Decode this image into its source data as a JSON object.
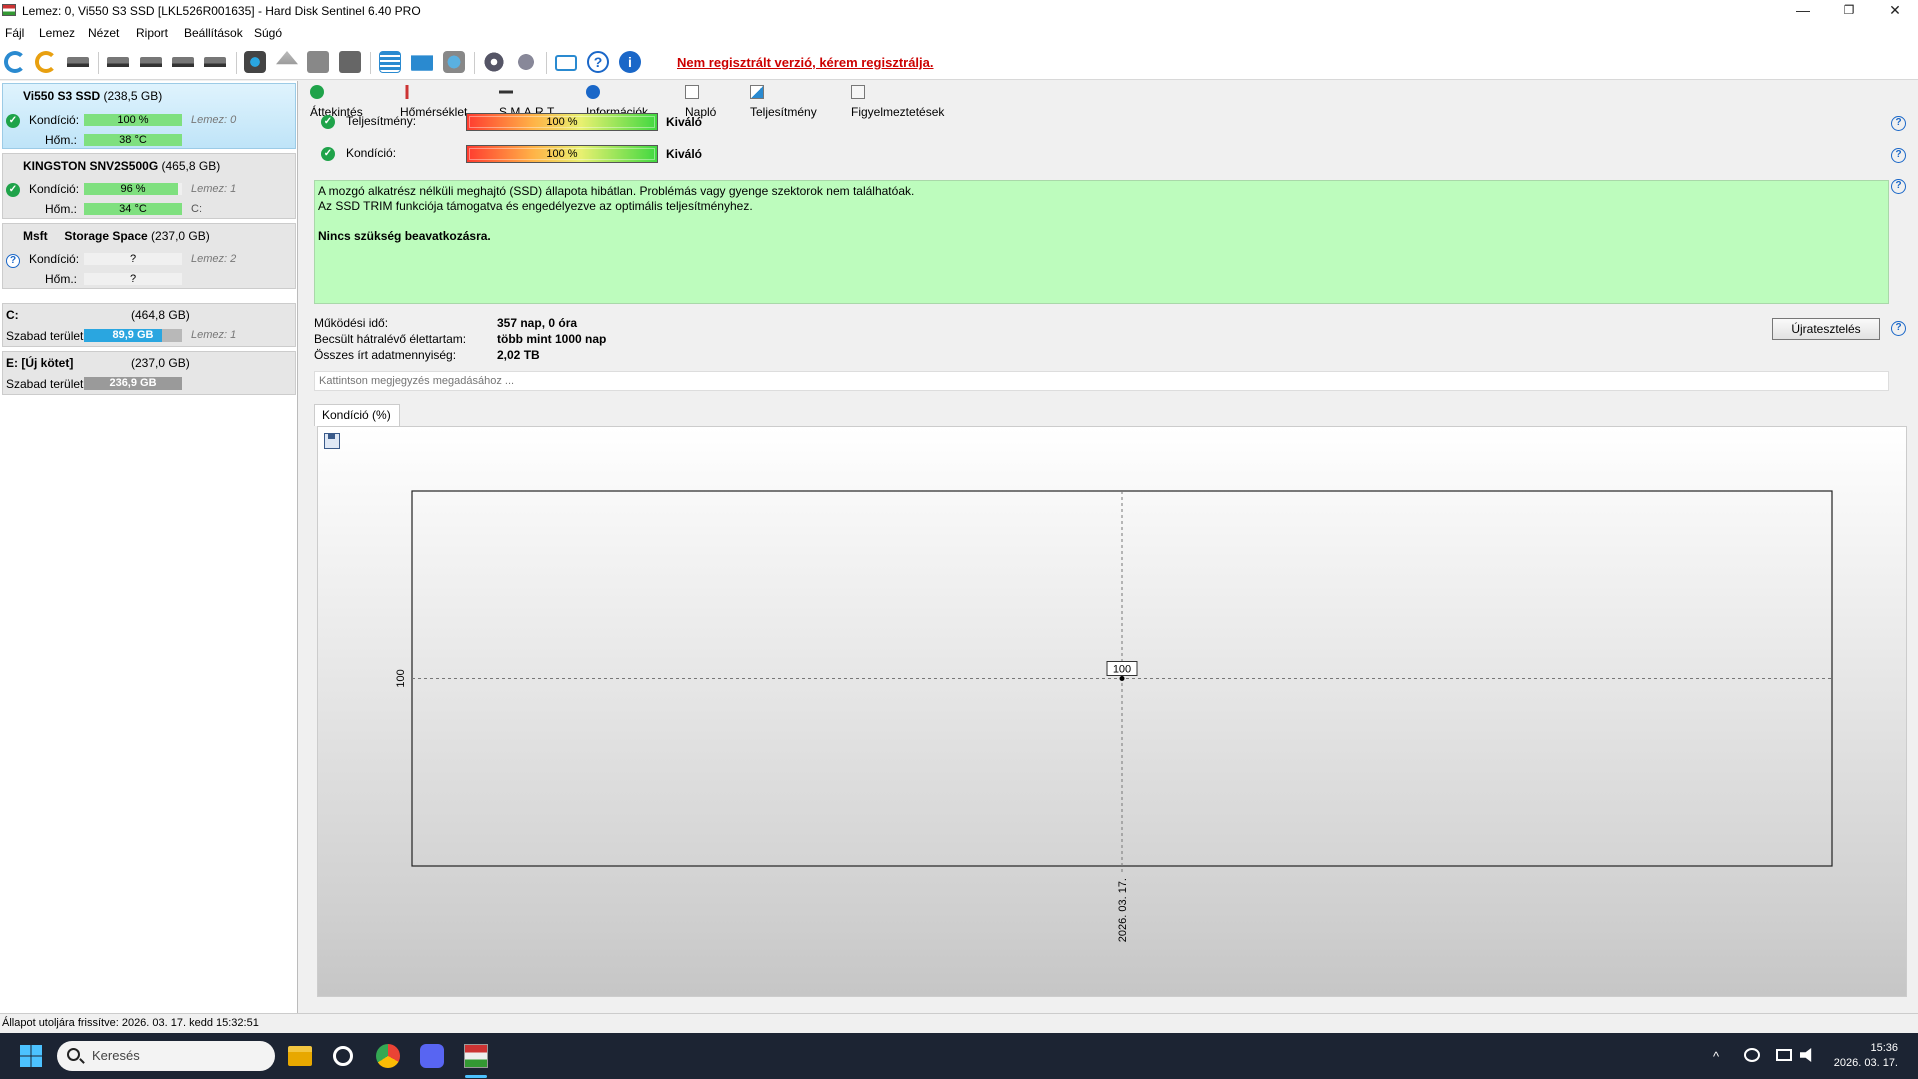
{
  "window": {
    "title": "Lemez: 0, Vi550 S3 SSD [LKL526R001635]  -  Hard Disk Sentinel 6.40 PRO",
    "minimize": "—",
    "maximize": "❐",
    "close": "✕"
  },
  "menu": [
    "Fájl",
    "Lemez",
    "Nézet",
    "Riport",
    "Beállítások",
    "Súgó"
  ],
  "toolbar": {
    "register_link": "Nem regisztrált verzió, kérem regisztrálja."
  },
  "disks": [
    {
      "name": "Vi550 S3 SSD",
      "size": "(238,5 GB)",
      "condition_label": "Kondíció:",
      "condition": "100 %",
      "condition_pct": 100,
      "temp_label": "Hőm.:",
      "temp": "38 °C",
      "temp_pct": 100,
      "note": "Lemez: 0",
      "note2": "",
      "status": "ok"
    },
    {
      "name": "KINGSTON SNV2S500G",
      "size": "(465,8 GB)",
      "condition_label": "Kondíció:",
      "condition": "96 %",
      "condition_pct": 96,
      "temp_label": "Hőm.:",
      "temp": "34 °C",
      "temp_pct": 100,
      "note": "Lemez: 1",
      "note2": "C:",
      "status": "ok"
    },
    {
      "name": "Msft     Storage Space",
      "size": "(237,0 GB)",
      "condition_label": "Kondíció:",
      "condition": "?",
      "condition_pct": 0,
      "temp_label": "Hőm.:",
      "temp": "?",
      "temp_pct": 0,
      "note": "Lemez: 2",
      "note2": "",
      "status": "unknown"
    }
  ],
  "volumes": [
    {
      "name": "C:",
      "size": "(464,8 GB)",
      "free_label": "Szabad terület",
      "free": "89,9 GB",
      "free_pct": 19,
      "note": "Lemez: 1"
    },
    {
      "name": "E: [Új kötet]",
      "size": "(237,0 GB)",
      "free_label": "Szabad terület",
      "free": "236,9 GB",
      "free_pct": 0,
      "note": ""
    }
  ],
  "tabs": [
    "Áttekintés",
    "Hőmérséklet",
    "S.M.A.R.T.",
    "Információk",
    "Napló",
    "Teljesítmény",
    "Figyelmeztetések"
  ],
  "overview": {
    "performance_label": "Teljesítmény:",
    "performance_value": "100 %",
    "performance_word": "Kiváló",
    "condition_label": "Kondíció:",
    "condition_value": "100 %",
    "condition_word": "Kiváló",
    "message_line1": "A mozgó alkatrész nélküli meghajtó (SSD) állapota hibátlan. Problémás vagy gyenge szektorok nem találhatóak.",
    "message_line2": "Az SSD TRIM funkciója támogatva és engedélyezve az optimális teljesítményhez.",
    "message_bold": "Nincs szükség beavatkozásra.",
    "uptime_label": "Működési idő:",
    "uptime_value": "357 nap, 0 óra",
    "remaining_label": "Becsült hátralévő élettartam:",
    "remaining_value": "több mint 1000 nap",
    "written_label": "Összes írt adatmennyiség:",
    "written_value": "2,02 TB",
    "retest_button": "Újratesztelés",
    "note_placeholder": "Kattintson megjegyzés megadásához ..."
  },
  "chart_tab": "Kondíció  (%)",
  "chart_data": {
    "type": "line",
    "title": "",
    "xlabel": "",
    "ylabel": "",
    "x": [
      "2026. 03. 17."
    ],
    "series": [
      {
        "values": [
          100
        ]
      }
    ],
    "y_tick_labels": [
      "100"
    ],
    "point_labels": [
      "100"
    ]
  },
  "statusbar": "Állapot utoljára frissítve: 2026. 03. 17. kedd 15:32:51",
  "taskbar": {
    "search_placeholder": "Keresés",
    "time": "15:36",
    "date": "2026. 03. 17.",
    "tray_up": "^"
  },
  "colors": {
    "accent": "#2aa6e0",
    "ok": "#1fa34a",
    "message_bg": "#bdfcbd",
    "register_link": "#cc0000"
  }
}
